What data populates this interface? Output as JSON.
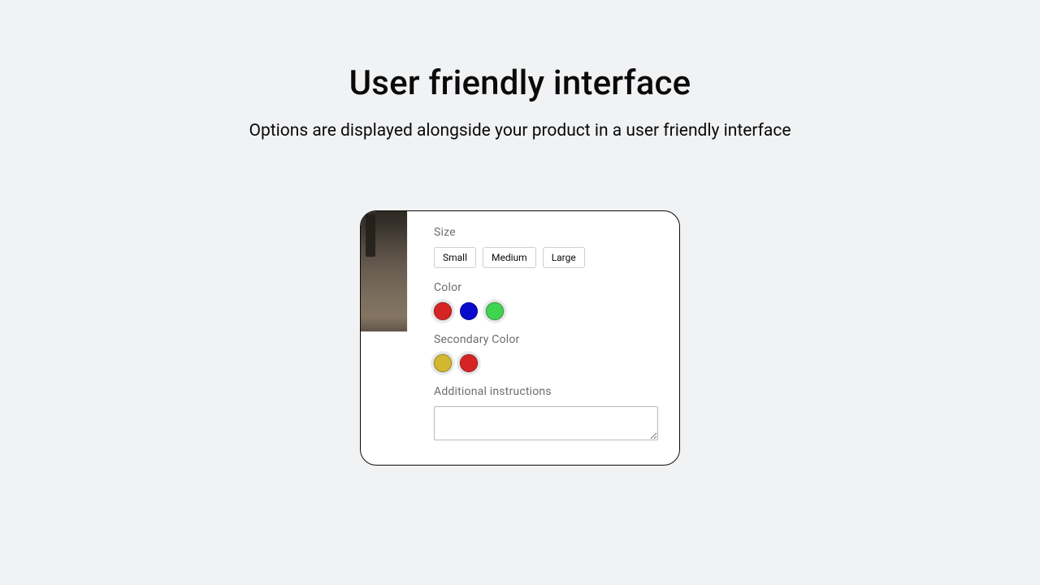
{
  "header": {
    "title": "User friendly interface",
    "subtitle": "Options are displayed alongside your product in a user friendly interface"
  },
  "product": {
    "image_name": "product-photo",
    "options": {
      "size": {
        "label": "Size",
        "choices": [
          "Small",
          "Medium",
          "Large"
        ]
      },
      "color": {
        "label": "Color",
        "swatches": [
          {
            "name": "red",
            "hex": "#d62424",
            "selected": true
          },
          {
            "name": "blue",
            "hex": "#0a0acc",
            "selected": false
          },
          {
            "name": "green",
            "hex": "#3fd44f",
            "selected": true
          }
        ]
      },
      "secondary_color": {
        "label": "Secondary Color",
        "swatches": [
          {
            "name": "gold",
            "hex": "#d3b82f",
            "selected": true
          },
          {
            "name": "red",
            "hex": "#d62424",
            "selected": true
          }
        ]
      },
      "instructions": {
        "label": "Additional instructions",
        "value": ""
      }
    }
  }
}
